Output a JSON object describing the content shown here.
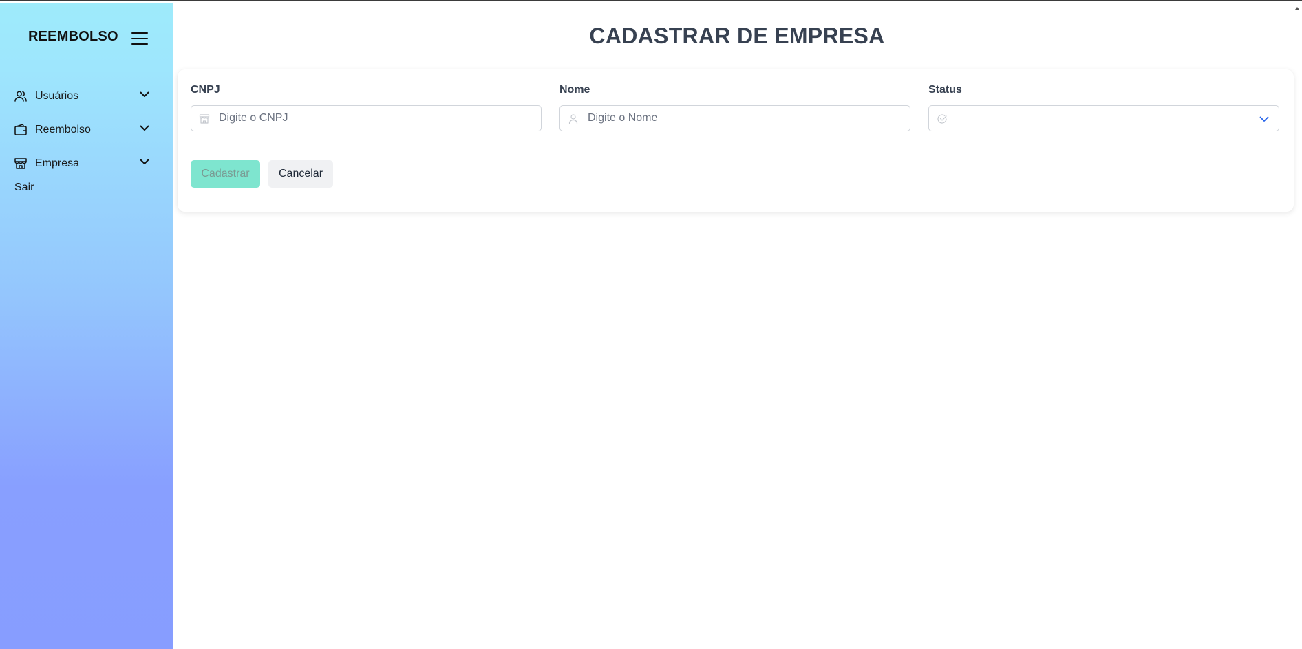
{
  "sidebar": {
    "brand": "REEMBOLSO",
    "menu_icon": "hamburger-icon",
    "items": [
      {
        "label": "Usuários",
        "icon": "users-icon"
      },
      {
        "label": "Reembolso",
        "icon": "wallet-icon"
      },
      {
        "label": "Empresa",
        "icon": "store-icon"
      }
    ],
    "logout": "Sair"
  },
  "main": {
    "title": "CADASTRAR DE EMPRESA",
    "form": {
      "cnpj": {
        "label": "CNPJ",
        "placeholder": "Digite o CNPJ",
        "value": "",
        "icon": "building-icon"
      },
      "nome": {
        "label": "Nome",
        "placeholder": "Digite o Nome",
        "value": "",
        "icon": "user-icon"
      },
      "status": {
        "label": "Status",
        "value": "",
        "icon": "check-circle-icon"
      }
    },
    "buttons": {
      "submit": "Cadastrar",
      "cancel": "Cancelar"
    }
  },
  "colors": {
    "sidebar_top": "#9eebfb",
    "sidebar_bottom": "#879dff",
    "primary_button": "#7ee5cf",
    "title": "#374151",
    "select_chevron": "#2563eb"
  }
}
